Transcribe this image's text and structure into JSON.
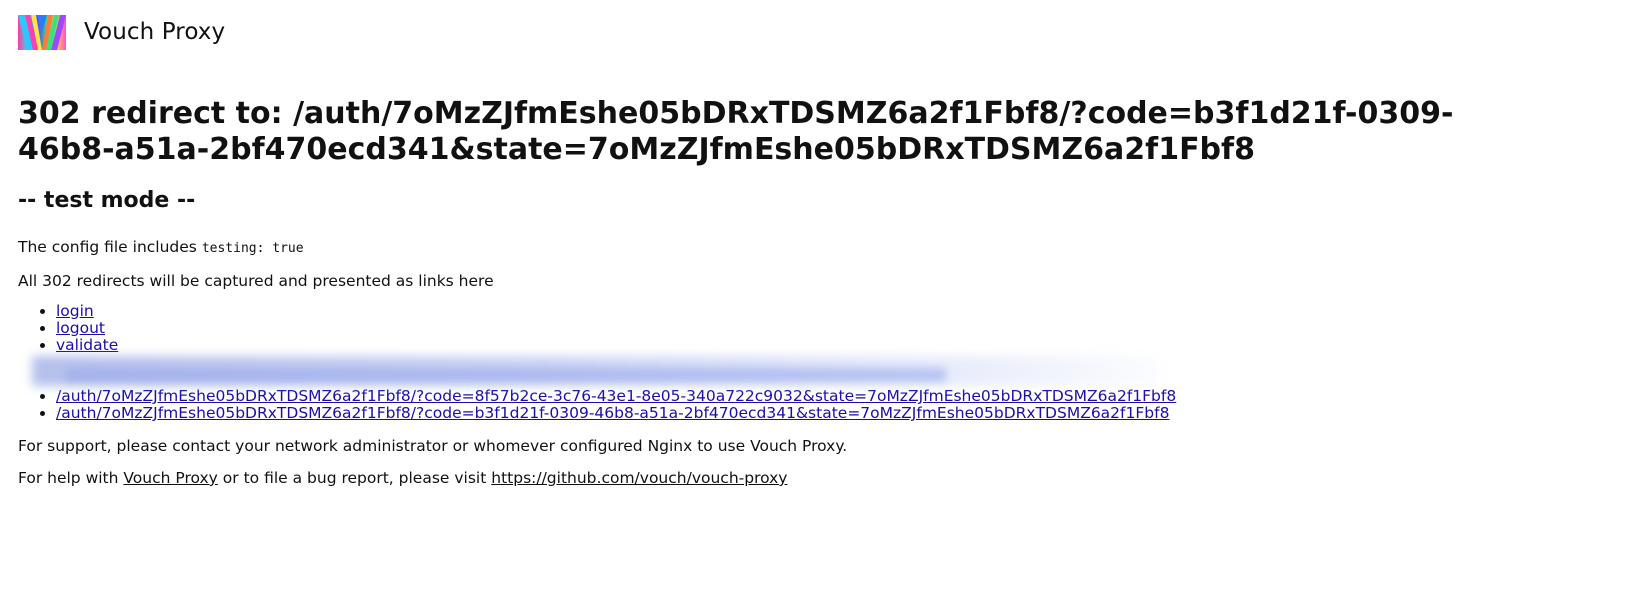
{
  "header": {
    "logo_icon": "vouch-proxy-logo-icon",
    "app_title": "Vouch Proxy"
  },
  "main": {
    "redirect_heading": "302 redirect to: /auth/7oMzZJfmEshe05bDRxTDSMZ6a2f1Fbf8/?code=b3f1d21f-0309-46b8-a51a-2bf470ecd341&state=7oMzZJfmEshe05bDRxTDSMZ6a2f1Fbf8",
    "test_mode_heading": "-- test mode --",
    "config_text": "The config file includes",
    "config_code": "testing: true",
    "capture_text": "All 302 redirects will be captured and presented as links here",
    "links": [
      {
        "label": "login"
      },
      {
        "label": "logout"
      },
      {
        "label": "validate"
      },
      {
        "label": "/auth/7oMzZJfmEshe05bDRxTDSMZ6a2f1Fbf8/?code=8f57b2ce-3c76-43e1-8e05-340a722c9032&state=7oMzZJfmEshe05bDRxTDSMZ6a2f1Fbf8"
      },
      {
        "label": "/auth/7oMzZJfmEshe05bDRxTDSMZ6a2f1Fbf8/?code=b3f1d21f-0309-46b8-a51a-2bf470ecd341&state=7oMzZJfmEshe05bDRxTDSMZ6a2f1Fbf8"
      }
    ],
    "support_text": "For support, please contact your network administrator or whomever configured Nginx to use Vouch Proxy.",
    "help_prefix": "For help with",
    "help_link_label": "Vouch Proxy",
    "help_middle": "or to file a bug report, please visit",
    "help_url_label": "https://github.com/vouch/vouch-proxy"
  },
  "colors": {
    "link": "#1a0dab",
    "text": "#111111",
    "background": "#ffffff"
  }
}
